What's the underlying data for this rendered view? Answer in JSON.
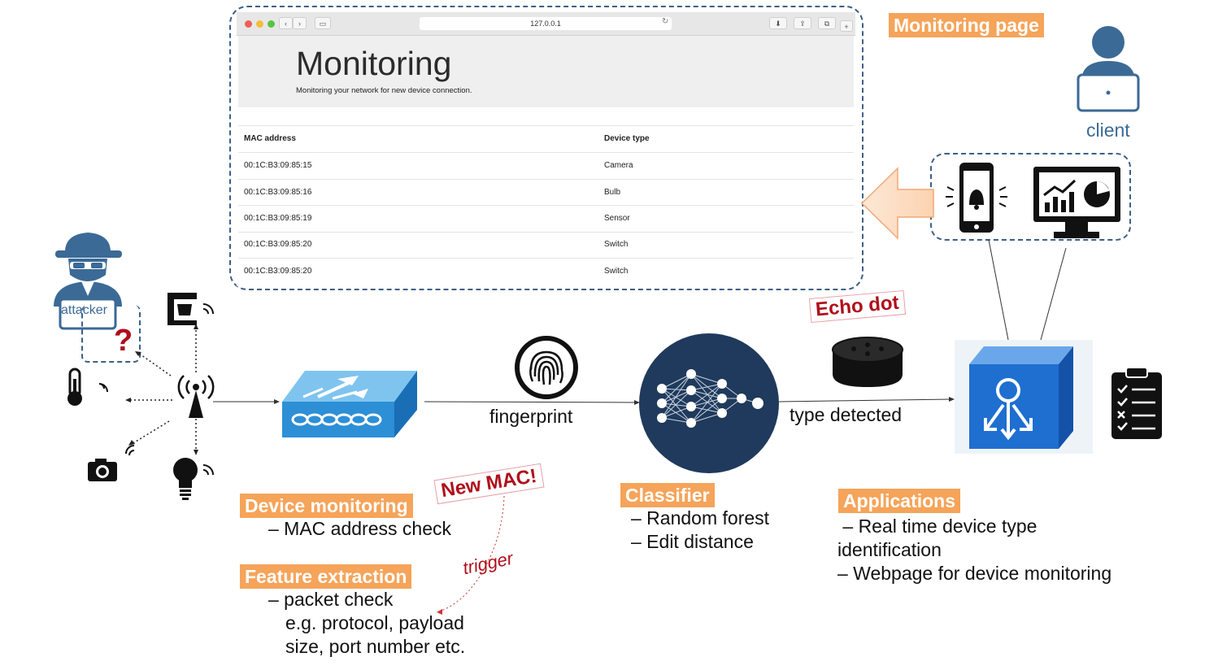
{
  "browser": {
    "url": "127.0.0.1",
    "title": "Monitoring",
    "subtitle": "Monitoring your network for new device connection.",
    "columns": [
      "MAC address",
      "Device type"
    ],
    "rows": [
      {
        "mac": "00:1C:B3:09:85:15",
        "type": "Camera"
      },
      {
        "mac": "00:1C:B3:09:85:16",
        "type": "Bulb"
      },
      {
        "mac": "00:1C:B3:09:85:19",
        "type": "Sensor"
      },
      {
        "mac": "00:1C:B3:09:85:20",
        "type": "Switch"
      },
      {
        "mac": "00:1C:B3:09:85:20",
        "type": "Switch"
      }
    ]
  },
  "labels": {
    "monitoring_page": "Monitoring page",
    "client": "client",
    "attacker": "attacker",
    "question": "?",
    "fingerprint": "fingerprint",
    "echo_dot": "Echo dot",
    "type_detected": "type detected",
    "new_mac": "New MAC!",
    "trigger": "trigger",
    "device_monitoring": "Device monitoring",
    "device_monitoring_items": [
      "– MAC address check"
    ],
    "feature_extraction": "Feature extraction",
    "feature_extraction_items": [
      "– packet check",
      "e.g. protocol, payload",
      "size, port number etc."
    ],
    "classifier": "Classifier",
    "classifier_items": [
      "– Random forest",
      "– Edit distance"
    ],
    "applications": "Applications",
    "applications_items": [
      " – Real time device type",
      "identification",
      "– Webpage for device monitoring"
    ]
  },
  "colors": {
    "accent_orange": "#f5a45a",
    "dark_blue": "#1f3a5c",
    "router_blue": "#2d8fd6",
    "app_blue": "#1e6fd0",
    "alert_red": "#b00d1a",
    "client_blue": "#3b6a96"
  },
  "icons": [
    "attacker-icon",
    "coffee-maker-icon",
    "thermometer-icon",
    "camera-icon",
    "bulb-icon",
    "antenna-icon",
    "router-icon",
    "fingerprint-icon",
    "neural-network-icon",
    "echo-dot-icon",
    "app-cube-icon",
    "clipboard-icon",
    "phone-bell-icon",
    "dashboard-monitor-icon",
    "client-user-icon",
    "arrow-left-icon"
  ]
}
